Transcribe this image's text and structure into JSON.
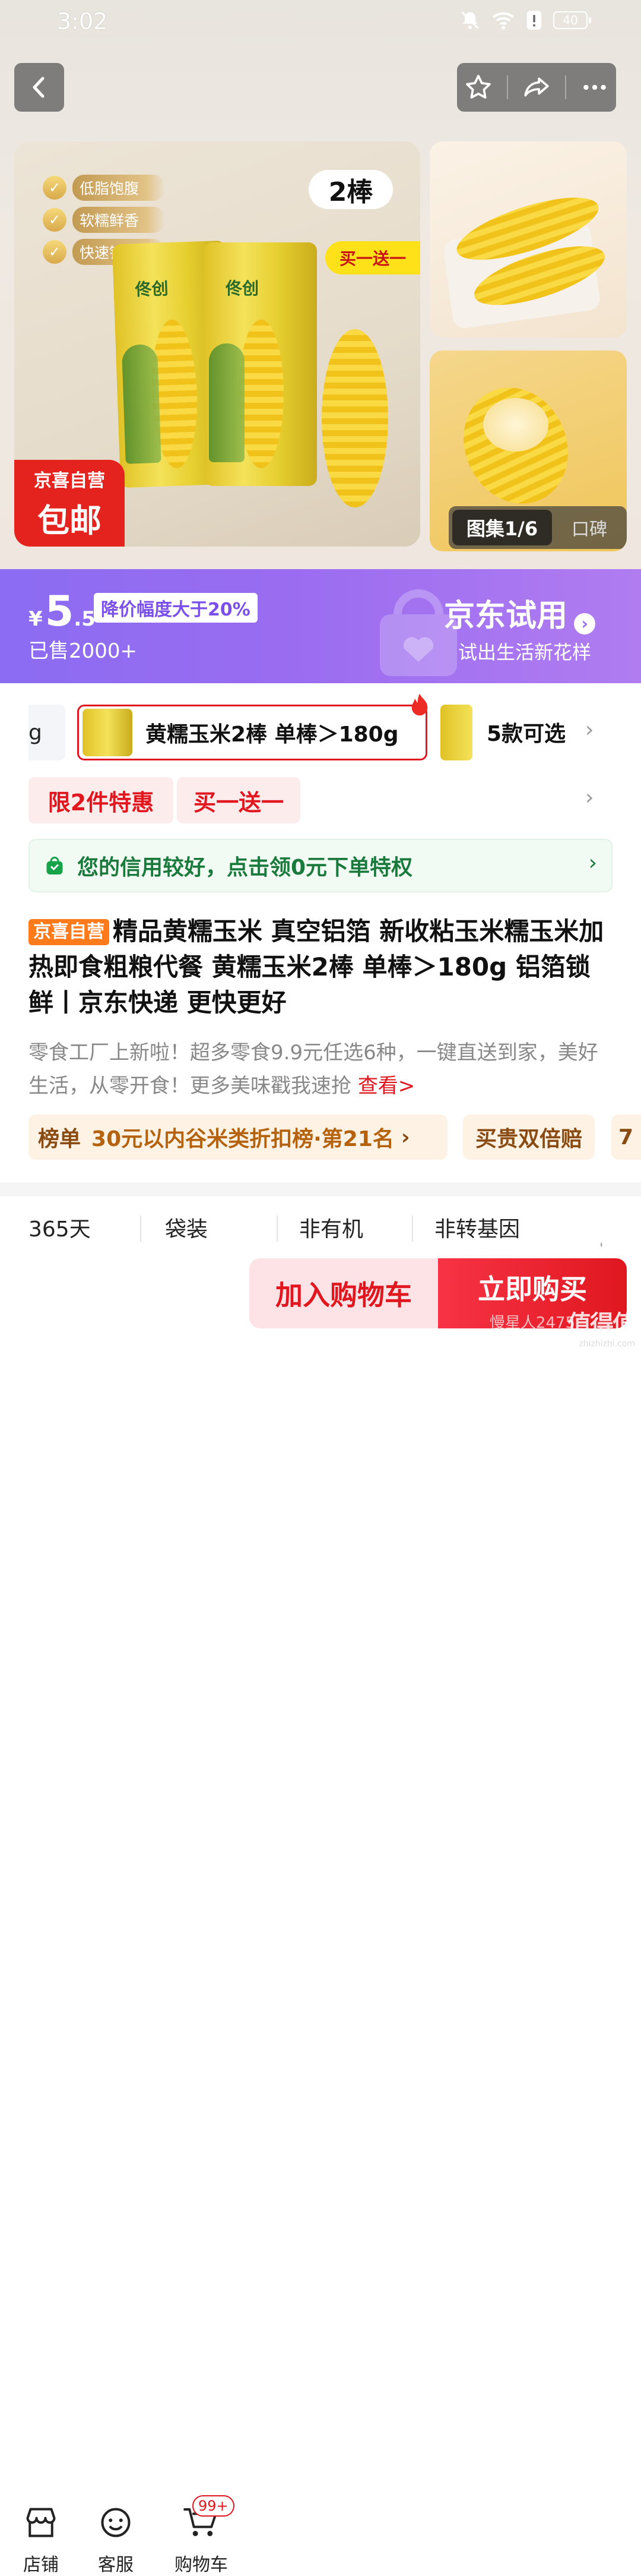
{
  "status_bar": {
    "time": "3:02",
    "battery": "40"
  },
  "gallery": {
    "features": [
      "低脂饱腹",
      "软糯鲜香",
      "快速锁鲜"
    ],
    "count_badge": "2棒",
    "promo_ribbon": "买一送一",
    "brand_on_pack": "佟创",
    "seller_badge_top": "京喜自营",
    "seller_badge_bottom": "包邮",
    "album_tab": "图集1/6",
    "reviews_tab": "口碑"
  },
  "price_band": {
    "currency": "¥",
    "price_int": "5",
    "price_dec": ".5",
    "discount_tag": "降价幅度大于20%",
    "sold": "已售2000+",
    "trial_title": "京东试用",
    "trial_subtitle": "试出生活新花样"
  },
  "variants": {
    "prev_partial": "g",
    "selected": "黄糯玉米2棒 单棒＞180g",
    "more": "5款可选"
  },
  "promos": [
    "限2件特惠",
    "买一送一"
  ],
  "credit_banner": "您的信用较好，点击领0元下单特权",
  "title": {
    "badge": "京喜自营",
    "text": "精品黄糯玉米 真空铝箔 新收粘玉米糯玉米加热即食粗粮代餐 黄糯玉米2棒 单棒＞180g 铝箔锁鲜丨京东快递 更快更好"
  },
  "description": {
    "text": "零食工厂上新啦！超多零食9.9元任选6种，一键直送到家，美好生活，从零开食！更多美味戳我速抢",
    "link": "查看>"
  },
  "rank": {
    "label": "榜单",
    "text": "30元以内谷米类折扣榜·第21名",
    "guarantee": "买贵双倍赔",
    "partial": "7"
  },
  "attributes": [
    "365天",
    "袋装",
    "非有机",
    "非转基因"
  ],
  "bottom_bar": {
    "shop": "店铺",
    "service": "客服",
    "cart": "购物车",
    "cart_badge": "99+",
    "add_cart": "加入购物车",
    "buy_now": "立即购买",
    "buy_sub": "慢星人2475"
  },
  "watermark": {
    "text": "值得值",
    "domain": "zhizhizhi.com"
  },
  "colors": {
    "accent_red": "#e0171f",
    "purple": "#8b6cf2",
    "green": "#1a7a3c",
    "orange": "#ff7a1a"
  }
}
